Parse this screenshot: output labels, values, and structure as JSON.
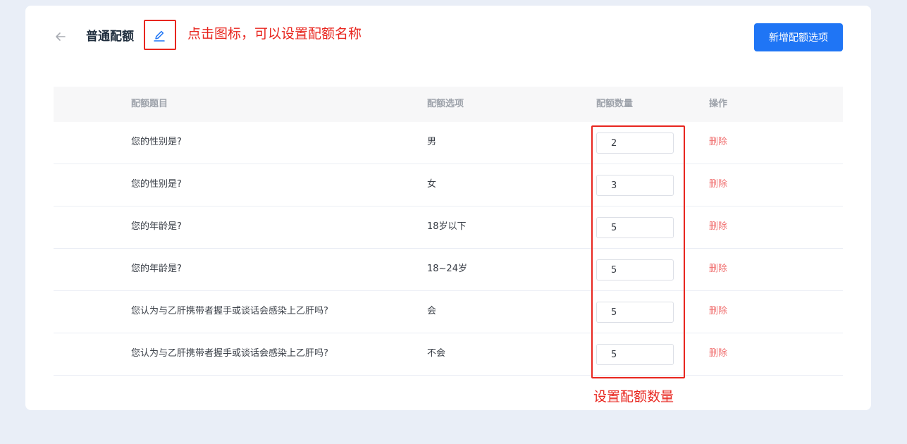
{
  "header": {
    "title": "普通配额",
    "add_button_label": "新增配额选项"
  },
  "annotations": {
    "edit_hint": "点击图标，可以设置配额名称",
    "quantity_hint": "设置配额数量"
  },
  "table": {
    "columns": [
      "配额题目",
      "配额选项",
      "配额数量",
      "操作"
    ],
    "rows": [
      {
        "question": "您的性别是?",
        "option": "男",
        "quantity": "2",
        "action": "删除"
      },
      {
        "question": "您的性别是?",
        "option": "女",
        "quantity": "3",
        "action": "删除"
      },
      {
        "question": "您的年龄是?",
        "option": "18岁以下",
        "quantity": "5",
        "action": "删除"
      },
      {
        "question": "您的年龄是?",
        "option": "18~24岁",
        "quantity": "5",
        "action": "删除"
      },
      {
        "question": "您认为与乙肝携带者握手或谈话会感染上乙肝吗?",
        "option": "会",
        "quantity": "5",
        "action": "删除"
      },
      {
        "question": "您认为与乙肝携带者握手或谈话会感染上乙肝吗?",
        "option": "不会",
        "quantity": "5",
        "action": "删除"
      }
    ]
  },
  "colors": {
    "primary": "#1f75f5",
    "danger": "#f06f6f",
    "annotation": "#e8261f",
    "background": "#e9eef7"
  },
  "icons": {
    "back": "arrow-left-icon",
    "edit": "pencil-edit-icon"
  }
}
